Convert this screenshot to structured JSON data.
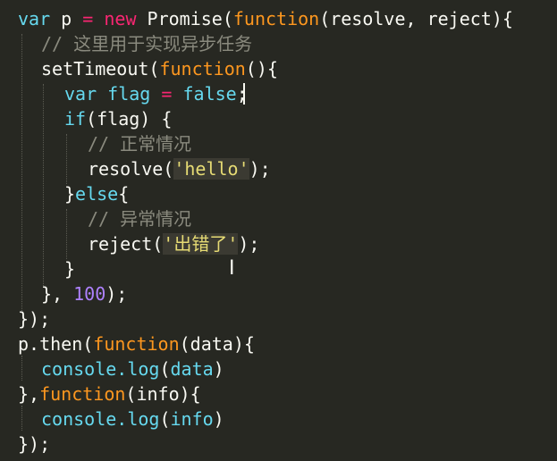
{
  "code": {
    "l1": {
      "kw1": "var",
      "name": "p",
      "op1": "=",
      "kw2": "new",
      "ctor": "Promise(",
      "fn": "function",
      "params": "(resolve, reject){"
    },
    "l2": {
      "comment": "// 这里用于实现异步任务"
    },
    "l3": {
      "call": "setTimeout(",
      "fn": "function",
      "tail": "(){"
    },
    "l4": {
      "kw": "var",
      "name": "flag",
      "op": "=",
      "val": "false",
      "tail": ";"
    },
    "l5": {
      "kw": "if",
      "cond": "(flag) {"
    },
    "l6": {
      "comment": "// 正常情况"
    },
    "l7": {
      "call": "resolve(",
      "str": "'hello'",
      "tail": ");"
    },
    "l8": {
      "head": "}",
      "kw": "else",
      "tail": "{"
    },
    "l9": {
      "comment": "// 异常情况"
    },
    "l10": {
      "call": "reject(",
      "str": "'出错了'",
      "tail": ");"
    },
    "l11": {
      "text": "}"
    },
    "l12": {
      "head": "},",
      "num": "100",
      "tail": ");"
    },
    "l13": {
      "text": "});"
    },
    "l14": {
      "obj": "p.then(",
      "fn": "function",
      "tail": "(data){"
    },
    "l15": {
      "obj": "console.",
      "method": "log",
      "open": "(",
      "arg": "data",
      "close": ")"
    },
    "l16": {
      "head": "},",
      "fn": "function",
      "tail": "(info){"
    },
    "l17": {
      "obj": "console.",
      "method": "log",
      "open": "(",
      "arg": "info",
      "close": ")"
    },
    "l18": {
      "text": "});"
    }
  },
  "theme": {
    "background": "#272822",
    "keyword": "#66d9ef",
    "function": "#fd971f",
    "operator": "#f92672",
    "number": "#ae81ff",
    "comment": "#8a8a7e",
    "string": "#e6db74"
  }
}
